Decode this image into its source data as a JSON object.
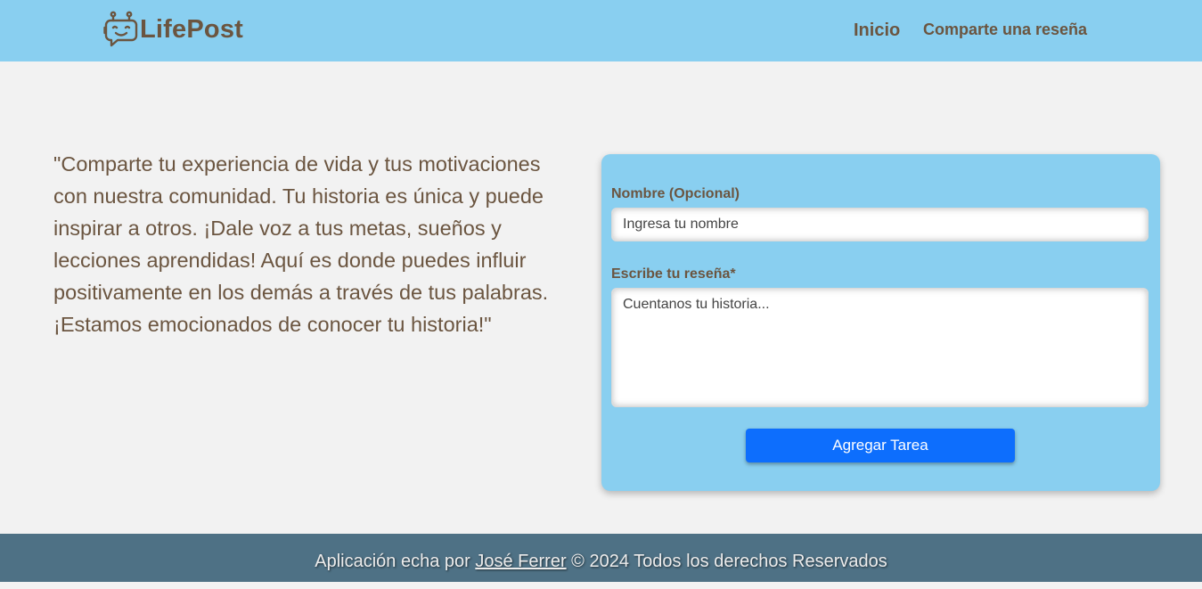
{
  "header": {
    "logo_text": "LifePost",
    "logo_icon": "chat-robot-icon",
    "nav": {
      "home": "Inicio",
      "share": "Comparte una reseña"
    }
  },
  "intro": {
    "text": "\"Comparte tu experiencia de vida y tus motivaciones con nuestra comunidad. Tu historia es única y puede inspirar a otros. ¡Dale voz a tus metas, sueños y lecciones aprendidas! Aquí es donde puedes influir positivamente en los demás a través de tus palabras. ¡Estamos emocionados de conocer tu historia!\""
  },
  "form": {
    "name_label": "Nombre (Opcional)",
    "name_placeholder": "Ingresa tu nombre",
    "review_label": "Escribe tu reseña*",
    "review_placeholder": "Cuentanos tu historia...",
    "submit_label": "Agregar Tarea"
  },
  "footer": {
    "prefix": "Aplicación echa por ",
    "author": "José Ferrer",
    "suffix": " © 2024 Todos los derechos Reservados"
  },
  "colors": {
    "header_bg": "#89cff0",
    "brand_text": "#6b5540",
    "button": "#0d6efd",
    "footer_bg": "#4e7185"
  }
}
